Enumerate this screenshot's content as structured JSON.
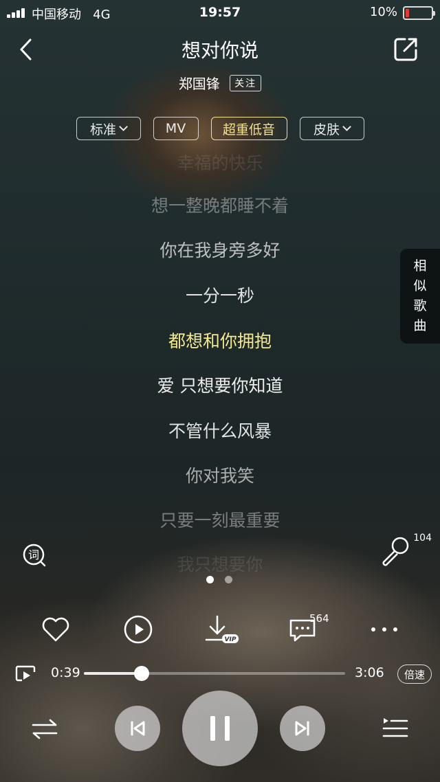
{
  "status_bar": {
    "carrier": "中国移动",
    "network": "4G",
    "time": "19:57",
    "battery_percent": "10%",
    "battery_level": 0.1
  },
  "header": {
    "title": "想对你说",
    "artist": "郑国锋",
    "follow_label": "关注"
  },
  "chips": [
    {
      "label": "标准",
      "dropdown": true
    },
    {
      "label": "MV",
      "dropdown": false
    },
    {
      "label": "超重低音",
      "dropdown": false,
      "active": true
    },
    {
      "label": "皮肤",
      "dropdown": true
    }
  ],
  "lyrics": {
    "lines": [
      "幸福的快乐",
      "想一整晚都睡不着",
      "你在我身旁多好",
      "一分一秒",
      "都想和你拥抱",
      "爱 只想要你知道",
      "不管什么风暴",
      "你对我笑",
      "只要一刻最重要",
      "我只想要你"
    ],
    "current_index": 4
  },
  "similar_songs": [
    "相",
    "似",
    "歌",
    "曲"
  ],
  "karaoke_count": "104",
  "pager": {
    "total": 2,
    "active": 0
  },
  "actions": {
    "comment_count": "564",
    "download_badge": "VIP"
  },
  "player": {
    "current_time": "0:39",
    "total_time": "3:06",
    "progress": 0.22,
    "speed_label": "倍速"
  },
  "colors": {
    "highlight": "#f4e98f",
    "battery_low": "#e53935"
  },
  "icons": [
    "back-icon",
    "share-icon",
    "lyric-search-icon",
    "microphone-icon",
    "heart-icon",
    "video-icon",
    "download-icon",
    "comment-icon",
    "more-icon",
    "cast-icon",
    "shuffle-icon",
    "previous-icon",
    "pause-icon",
    "next-icon",
    "playlist-icon"
  ]
}
